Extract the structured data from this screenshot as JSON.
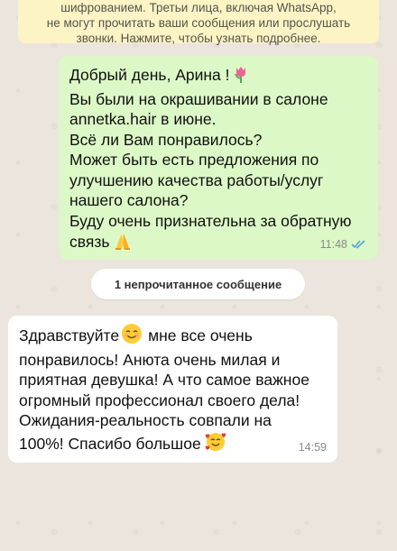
{
  "encryption_notice": {
    "line1": "шифрованием. Третьи лица, включая WhatsApp,",
    "line2": "не могут прочитать ваши сообщения или прослушать",
    "line3": "звонки. Нажмите, чтобы узнать подробнее."
  },
  "outgoing_message": {
    "lines": [
      "Добрый день, Арина !",
      "Вы были на окрашивании в салоне",
      "annetka.hair в июне.",
      "Всё ли Вам понравилось?",
      "Может быть есть предложения по",
      "улучшению качества работы/услуг",
      "нашего салона?",
      "Буду очень признательна за обратную",
      "связь"
    ],
    "time": "11:48",
    "emojis": [
      "tulip-icon",
      "folded-hands-icon"
    ],
    "read_status": "double-check-read"
  },
  "unread_divider": {
    "label": "1 непрочитанное сообщение"
  },
  "incoming_message": {
    "lines": [
      "Здравствуйте",
      "мне все очень",
      "понравилось! Анюта очень милая и",
      "приятная девушка! А что самое важное",
      "огромный профессионал своего дела!",
      "Ожидания-реальность совпали на",
      "100%! Спасибо большое"
    ],
    "time": "14:59",
    "emojis": [
      "smiling-face-icon",
      "smiling-face-with-hearts-icon"
    ]
  },
  "colors": {
    "outgoing_bubble": "#dcf8c6",
    "incoming_bubble": "#ffffff",
    "notice_bg": "#fdf4c5",
    "read_ticks": "#4fa3e0"
  }
}
